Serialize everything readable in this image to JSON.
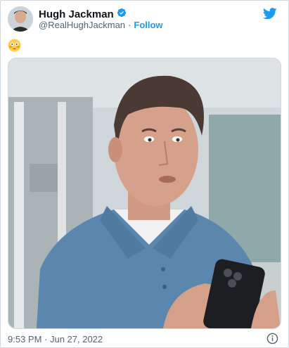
{
  "tweet": {
    "author": {
      "display_name": "Hugh Jackman",
      "verified": true,
      "handle": "@RealHughJackman",
      "separator": "·",
      "follow_label": "Follow"
    },
    "text_emoji": "😳",
    "timestamp": "9:53 PM · Jun 27, 2022"
  },
  "icons": {
    "verified": "verified-badge-icon",
    "brand": "twitter-bird-icon",
    "info": "info-icon"
  },
  "colors": {
    "accent": "#1d9bf0",
    "text_primary": "#0f1419",
    "text_secondary": "#536471",
    "border": "#cfd9de"
  }
}
